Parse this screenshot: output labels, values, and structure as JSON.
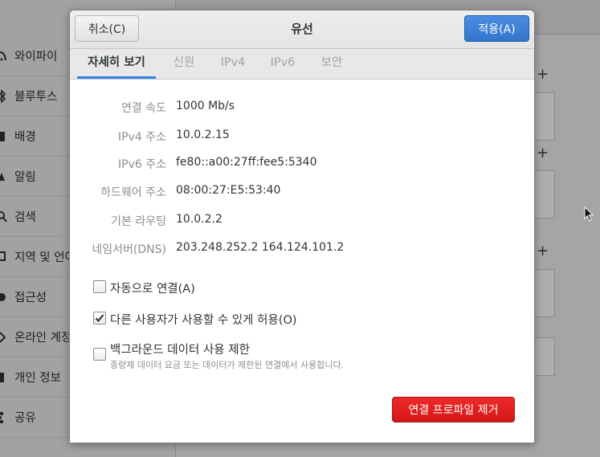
{
  "background": {
    "sidebar_items": [
      {
        "label": "와이파이",
        "icon": "wifi-icon"
      },
      {
        "label": "블루투스",
        "icon": "bluetooth-icon"
      },
      {
        "label": "배경",
        "icon": "background-icon"
      },
      {
        "label": "알림",
        "icon": "notification-icon"
      },
      {
        "label": "검색",
        "icon": "search-icon"
      },
      {
        "label": "지역 및 언어",
        "icon": "region-icon"
      },
      {
        "label": "접근성",
        "icon": "accessibility-icon"
      },
      {
        "label": "온라인 계정",
        "icon": "online-accounts-icon"
      },
      {
        "label": "개인 정보",
        "icon": "privacy-icon"
      },
      {
        "label": "공유",
        "icon": "share-icon"
      }
    ],
    "plus_symbol": "+"
  },
  "dialog": {
    "title": "유선",
    "cancel_label": "취소(C)",
    "apply_label": "적용(A)",
    "tabs": [
      {
        "label": "자세히 보기",
        "active": true
      },
      {
        "label": "신원",
        "active": false
      },
      {
        "label": "IPv4",
        "active": false
      },
      {
        "label": "IPv6",
        "active": false
      },
      {
        "label": "보안",
        "active": false
      }
    ],
    "details": [
      {
        "label": "연결 속도",
        "value": "1000 Mb/s"
      },
      {
        "label": "IPv4 주소",
        "value": "10.0.2.15"
      },
      {
        "label": "IPv6 주소",
        "value": "fe80::a00:27ff:fee5:5340"
      },
      {
        "label": "하드웨어 주소",
        "value": "08:00:27:E5:53:40"
      },
      {
        "label": "기본 라우팅",
        "value": "10.0.2.2"
      },
      {
        "label": "네임서버(DNS)",
        "value": "203.248.252.2 164.124.101.2"
      }
    ],
    "auto_connect": {
      "label": "자동으로 연결(A)",
      "checked": false
    },
    "allow_others": {
      "label": "다른 사용자가 사용할 수 있게 허용(O)",
      "checked": true
    },
    "restrict_background": {
      "label": "백그라운드 데이터 사용 제한",
      "description": "종량제 데이터 요금 또는 데이터가 제한된 연결에서 사용합니다.",
      "checked": false
    },
    "remove_label": "연결 프로파일 제거"
  },
  "colors": {
    "accent": "#3584e4",
    "apply_button": "#3a7bd5",
    "destructive": "#e01b1b"
  }
}
